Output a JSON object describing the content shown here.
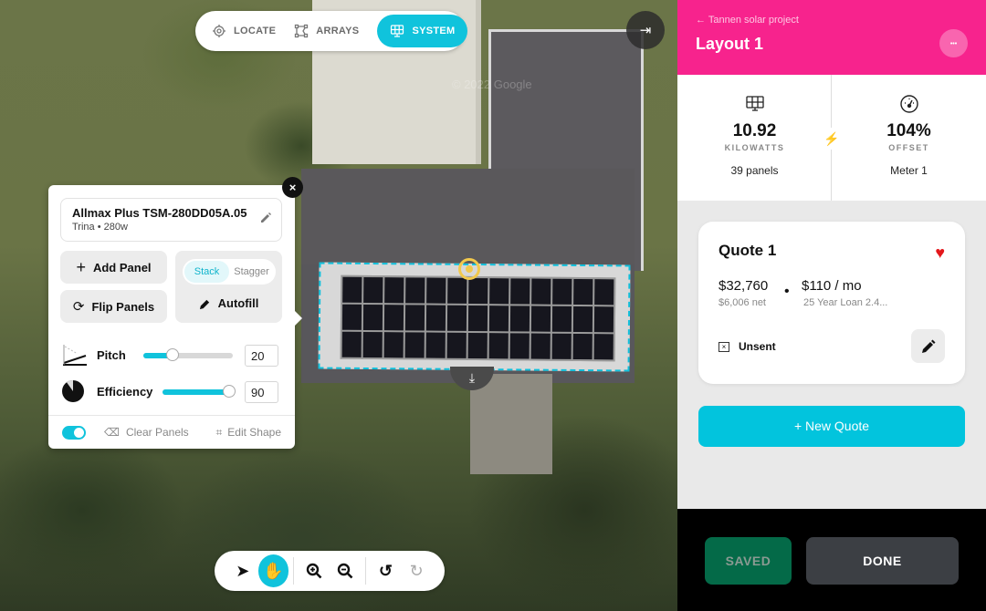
{
  "map": {
    "watermark": "© 2022 Google",
    "array": {
      "rows": 3,
      "columns": 13
    },
    "exit_icon": "arrow-right-to-bar-icon",
    "download_icon": "download-icon"
  },
  "topnav": {
    "items": [
      {
        "label": "LOCATE",
        "icon": "crosshair-icon",
        "active": false
      },
      {
        "label": "ARRAYS",
        "icon": "shape-icon",
        "active": false
      },
      {
        "label": "SYSTEM",
        "icon": "solar-panel-icon",
        "active": true
      }
    ]
  },
  "array_panel": {
    "close_label": "×",
    "module": {
      "name": "Allmax Plus TSM-280DD05A.05",
      "subtitle": "Trina • 280w"
    },
    "add_panel_label": "Add Panel",
    "flip_panels_label": "Flip Panels",
    "layout_options": [
      {
        "label": "Stack",
        "selected": true
      },
      {
        "label": "Stagger",
        "selected": false
      }
    ],
    "autofill_label": "Autofill",
    "pitch": {
      "label": "Pitch",
      "value": "20",
      "slider_fraction": 0.33
    },
    "efficiency": {
      "label": "Efficiency",
      "value": "90",
      "slider_fraction": 0.95
    },
    "toggle_on": true,
    "clear_panels_label": "Clear Panels",
    "edit_shape_label": "Edit Shape"
  },
  "toolbar": {
    "tools": [
      "select-pointer",
      "pan-hand",
      "zoom-in",
      "zoom-out",
      "undo",
      "redo"
    ],
    "active_tool": "pan-hand"
  },
  "sidebar": {
    "back_label": "← Tannen solar project",
    "title": "Layout 1",
    "more_label": "•••",
    "system": {
      "value": "10.92",
      "unit": "KILOWATTS",
      "sub": "39 panels"
    },
    "offset": {
      "value": "104%",
      "unit": "OFFSET",
      "sub": "Meter 1"
    },
    "bolt": "⚡",
    "quote": {
      "title": "Quote 1",
      "favorite": true,
      "price": "$32,760",
      "net": "$6,006 net",
      "separator": "•",
      "monthly": "$110 / mo",
      "loan": "25 Year Loan 2.4...",
      "status": "Unsent",
      "status_icon_glyph": "×"
    },
    "new_quote_label": "+ New Quote",
    "saved_label": "SAVED",
    "done_label": "DONE"
  },
  "colors": {
    "brand_pink": "#f7238d",
    "accent_cyan": "#10c3dc",
    "saved_green": "#046a48",
    "heart_red": "#e4171b"
  }
}
